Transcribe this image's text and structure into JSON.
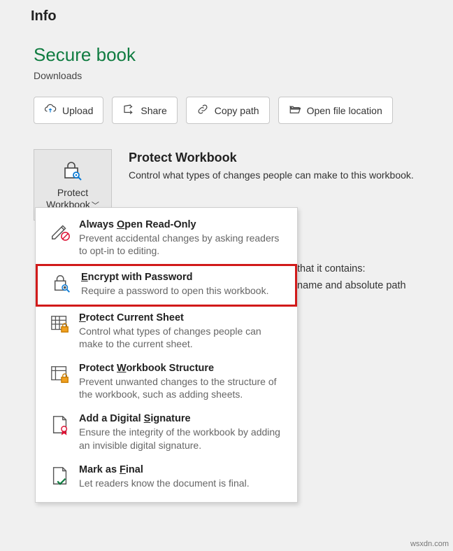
{
  "page_title": "Info",
  "doc_title": "Secure book",
  "doc_path": "Downloads",
  "actions": {
    "upload": "Upload",
    "share": "Share",
    "copy_path": "Copy path",
    "open_location": "Open file location"
  },
  "protect_btn": {
    "line1": "Protect",
    "line2": "Workbook"
  },
  "protect_section": {
    "heading": "Protect Workbook",
    "desc": "Control what types of changes people can make to this workbook."
  },
  "peek": {
    "line1": "that it contains:",
    "line2": "name and absolute path"
  },
  "menu": {
    "items": [
      {
        "title_pre": "Always ",
        "title_u": "O",
        "title_post": "pen Read-Only",
        "desc": "Prevent accidental changes by asking readers to opt-in to editing."
      },
      {
        "title_pre": "",
        "title_u": "E",
        "title_post": "ncrypt with Password",
        "desc": "Require a password to open this workbook."
      },
      {
        "title_pre": "",
        "title_u": "P",
        "title_post": "rotect Current Sheet",
        "desc": "Control what types of changes people can make to the current sheet."
      },
      {
        "title_pre": "Protect ",
        "title_u": "W",
        "title_post": "orkbook Structure",
        "desc": "Prevent unwanted changes to the structure of the workbook, such as adding sheets."
      },
      {
        "title_pre": "Add a Digital ",
        "title_u": "S",
        "title_post": "ignature",
        "desc": "Ensure the integrity of the workbook by adding an invisible digital signature."
      },
      {
        "title_pre": "Mark as ",
        "title_u": "F",
        "title_post": "inal",
        "desc": "Let readers know the document is final."
      }
    ]
  },
  "watermark": "wsxdn.com"
}
